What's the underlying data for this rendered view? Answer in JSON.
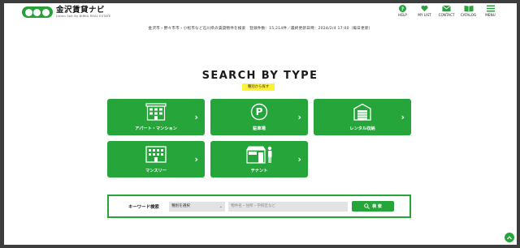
{
  "header": {
    "logo_title": "金沢賃貸ナビ",
    "logo_sub": "Listen Salt By BIRKA REAL ESTATE",
    "nav": [
      {
        "label": "HELP",
        "icon": "help-icon"
      },
      {
        "label": "MY LIST",
        "icon": "heart-icon"
      },
      {
        "label": "CONTACT",
        "icon": "mail-icon"
      },
      {
        "label": "CATALOG",
        "icon": "book-icon"
      },
      {
        "label": "MENU",
        "icon": "menu-icon"
      }
    ]
  },
  "infobar": "金沢市・野々市市・小松市など石川県の賃貸物件を検索　登録件数：15,214件／最終更新日時：2024/2/4 17:00（毎日更新）",
  "section": {
    "title": "SEARCH BY TYPE",
    "subtitle": "種別から探す"
  },
  "tiles": [
    {
      "label": "アパート・マンション",
      "icon": "apartment-icon"
    },
    {
      "label": "駐車場",
      "icon": "parking-icon"
    },
    {
      "label": "レンタル収納",
      "icon": "storage-icon"
    },
    {
      "label": "マンスリー",
      "icon": "monthly-building-icon"
    },
    {
      "label": "テナント",
      "icon": "tenant-shop-icon"
    }
  ],
  "arrow": "›",
  "keyword": {
    "label": "キーワード検索",
    "select_value": "種別を選択",
    "input_placeholder": "物件名・住所・学校区など",
    "button_label": "検 索"
  },
  "colors": {
    "brand_green": "#26a53b",
    "highlight_yellow": "#fff03a",
    "frame": "#3d3d3d"
  }
}
